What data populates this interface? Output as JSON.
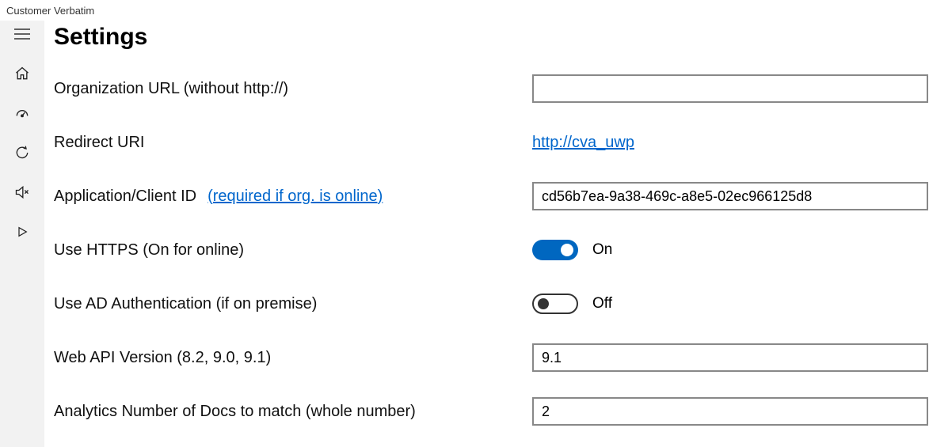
{
  "window": {
    "title": "Customer Verbatim"
  },
  "page": {
    "title": "Settings"
  },
  "fields": {
    "org_url": {
      "label": "Organization URL (without http://)",
      "value": ""
    },
    "redirect_uri": {
      "label": "Redirect URI",
      "value": "http://cva_uwp"
    },
    "client_id": {
      "label": "Application/Client ID",
      "hint": "(required if org. is online)",
      "value": "cd56b7ea-9a38-469c-a8e5-02ec966125d8"
    },
    "use_https": {
      "label": "Use HTTPS (On for online)",
      "state_label": "On",
      "on": true
    },
    "use_ad_auth": {
      "label": "Use AD Authentication (if on premise)",
      "state_label": "Off",
      "on": false
    },
    "api_version": {
      "label": "Web API Version (8.2, 9.0, 9.1)",
      "value": "9.1"
    },
    "analytics_docs": {
      "label": "Analytics Number of Docs to match (whole number)",
      "value": "2"
    }
  }
}
